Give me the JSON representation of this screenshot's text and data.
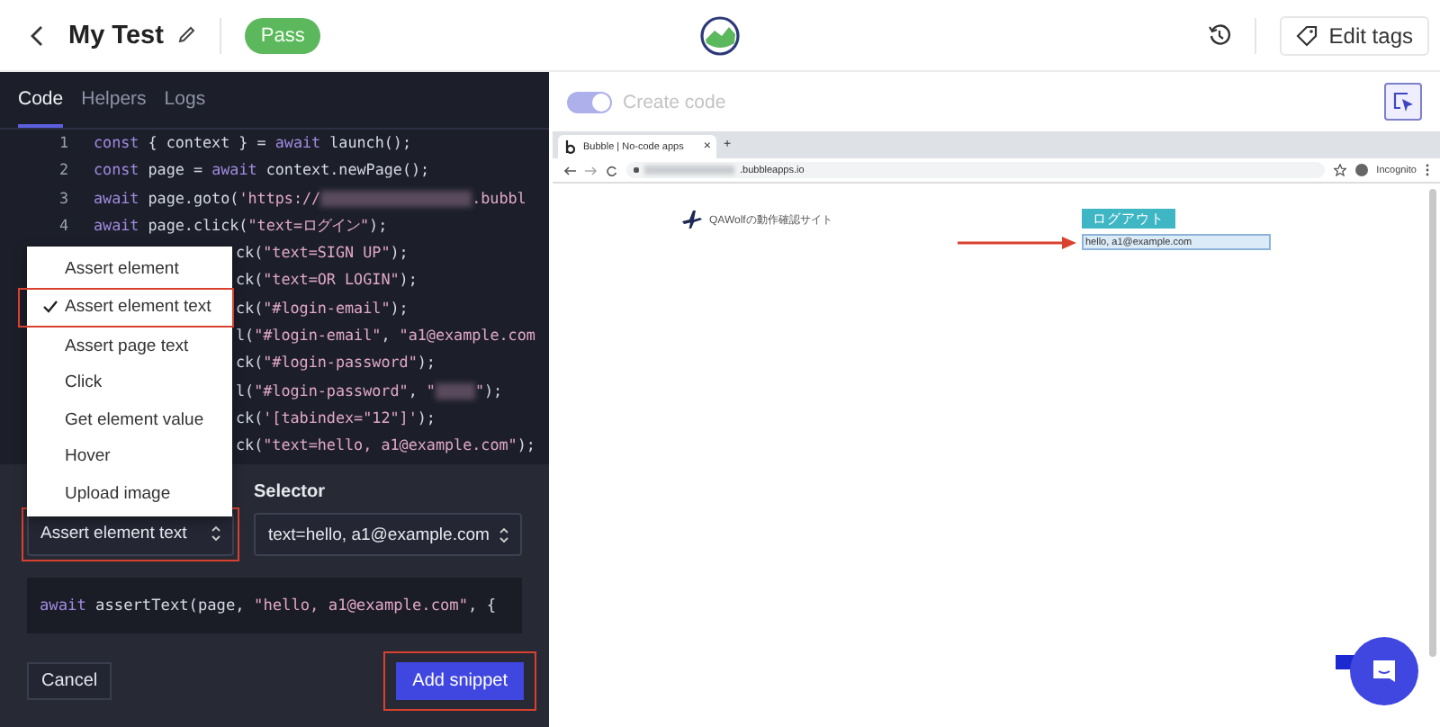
{
  "header": {
    "title": "My Test",
    "status": {
      "label": "Pass",
      "kind": "pass"
    },
    "edit_tags": "Edit tags"
  },
  "editor": {
    "tabs": [
      {
        "label": "Code",
        "selected": true
      },
      {
        "label": "Helpers",
        "selected": false
      },
      {
        "label": "Logs",
        "selected": false
      }
    ],
    "lines": [
      {
        "number": "1",
        "covered": false,
        "parts": [
          {
            "kind": "kw",
            "text": "const"
          },
          {
            "kind": "plain",
            "text": " { context } = "
          },
          {
            "kind": "kw",
            "text": "await"
          },
          {
            "kind": "plain",
            "text": " launch();"
          }
        ]
      },
      {
        "number": "2",
        "covered": false,
        "parts": [
          {
            "kind": "kw",
            "text": "const"
          },
          {
            "kind": "plain",
            "text": " page = "
          },
          {
            "kind": "kw",
            "text": "await"
          },
          {
            "kind": "plain",
            "text": " context.newPage();"
          }
        ]
      },
      {
        "number": "3",
        "covered": false,
        "parts": [
          {
            "kind": "kw",
            "text": "await"
          },
          {
            "kind": "plain",
            "text": " page.goto("
          },
          {
            "kind": "str",
            "text": "'https://"
          },
          {
            "kind": "redacted"
          },
          {
            "kind": "str",
            "text": ".bubbl"
          }
        ]
      },
      {
        "number": "4",
        "covered": false,
        "parts": [
          {
            "kind": "kw",
            "text": "await"
          },
          {
            "kind": "plain",
            "text": " page.click("
          },
          {
            "kind": "str",
            "text": "\"text=ログイン\""
          },
          {
            "kind": "plain",
            "text": ");"
          }
        ]
      },
      {
        "covered": true,
        "parts": [
          {
            "kind": "plain",
            "text": "ck("
          },
          {
            "kind": "str",
            "text": "\"text=SIGN UP\""
          },
          {
            "kind": "plain",
            "text": ");"
          }
        ]
      },
      {
        "covered": true,
        "parts": [
          {
            "kind": "plain",
            "text": "ck("
          },
          {
            "kind": "str",
            "text": "\"text=OR LOGIN\""
          },
          {
            "kind": "plain",
            "text": ");"
          }
        ]
      },
      {
        "covered": true,
        "parts": [
          {
            "kind": "plain",
            "text": "ck("
          },
          {
            "kind": "str",
            "text": "\"#login-email\""
          },
          {
            "kind": "plain",
            "text": ");"
          }
        ]
      },
      {
        "covered": true,
        "parts": [
          {
            "kind": "plain",
            "text": "l("
          },
          {
            "kind": "str",
            "text": "\"#login-email\""
          },
          {
            "kind": "plain",
            "text": ", "
          },
          {
            "kind": "str",
            "text": "\"a1@example.com"
          }
        ]
      },
      {
        "covered": true,
        "parts": [
          {
            "kind": "plain",
            "text": "ck("
          },
          {
            "kind": "str",
            "text": "\"#login-password\""
          },
          {
            "kind": "plain",
            "text": ");"
          }
        ]
      },
      {
        "covered": true,
        "parts": [
          {
            "kind": "plain",
            "text": "l("
          },
          {
            "kind": "str",
            "text": "\"#login-password\""
          },
          {
            "kind": "plain",
            "text": ", "
          },
          {
            "kind": "str",
            "text": "\""
          },
          {
            "kind": "redacted"
          },
          {
            "kind": "str",
            "text": "\""
          },
          {
            "kind": "plain",
            "text": ");"
          }
        ]
      },
      {
        "covered": true,
        "parts": [
          {
            "kind": "plain",
            "text": "ck("
          },
          {
            "kind": "str",
            "text": "'[tabindex=\"12\"]'"
          },
          {
            "kind": "plain",
            "text": ");"
          }
        ]
      },
      {
        "covered": true,
        "parts": [
          {
            "kind": "plain",
            "text": "ck("
          },
          {
            "kind": "str",
            "text": "\"text=hello, a1@example.com\""
          },
          {
            "kind": "plain",
            "text": ");"
          }
        ]
      }
    ]
  },
  "menu": {
    "items": [
      {
        "label": "Assert element",
        "selected": false,
        "highlighted": false
      },
      {
        "label": "Assert element text",
        "selected": true,
        "highlighted": true
      },
      {
        "label": "Assert page text",
        "selected": false,
        "highlighted": false
      },
      {
        "label": "Click",
        "selected": false,
        "highlighted": false
      },
      {
        "label": "Get element value",
        "selected": false,
        "highlighted": false
      },
      {
        "label": "Hover",
        "selected": false,
        "highlighted": false
      },
      {
        "label": "Upload image",
        "selected": false,
        "highlighted": false
      }
    ]
  },
  "snippet": {
    "action": {
      "value": "Assert element text",
      "highlighted": true
    },
    "selector_label": "Selector",
    "selector": {
      "value": "text=hello, a1@example.com"
    },
    "preview": [
      {
        "kind": "kw",
        "text": "await"
      },
      {
        "kind": "plain",
        "text": " assertText(page, "
      },
      {
        "kind": "str",
        "text": "\"hello, a1@example.com\""
      },
      {
        "kind": "plain",
        "text": ", {"
      }
    ],
    "cancel": "Cancel",
    "add": {
      "label": "Add snippet",
      "highlighted": true
    }
  },
  "preview": {
    "toggle": {
      "label": "Create code",
      "on": true
    },
    "browser": {
      "tab_title": "Bubble | No-code apps",
      "tab_close": "×",
      "new_tab": "+",
      "address": ".bubbleapps.io",
      "profile": "Incognito",
      "page": {
        "site_title": "QAWolfの動作確認サイト",
        "logout": "ログアウト",
        "greeting": "hello, a1@example.com"
      }
    }
  }
}
